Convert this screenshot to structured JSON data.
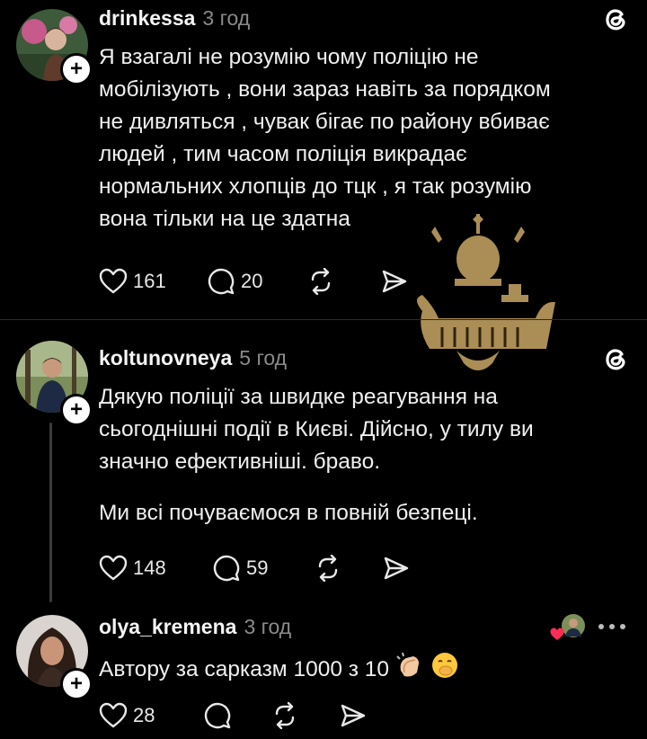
{
  "posts": [
    {
      "username": "drinkessa",
      "time": "3 год",
      "lines": [
        "Я взагалі не розумію чому поліцію не",
        "мобілізують , вони зараз навіть за порядком",
        "не дивляться , чувак бігає по району вбиває",
        "людей , тим часом поліція викрадає",
        "нормальних хлопців до тцк , я так розумію",
        "вона тільки на це здатна"
      ],
      "likes": "161",
      "replies": "20"
    },
    {
      "username": "koltunovneya",
      "time": "5 год",
      "lines": [
        "Дякую поліції за швидке реагування на",
        "сьогоднішні події в Києві. Дійсно, у тилу ви",
        "значно ефективніші. браво."
      ],
      "lines2": [
        "Ми всі почуваємося в повній безпеці."
      ],
      "likes": "148",
      "replies": "59"
    },
    {
      "username": "olya_kremena",
      "time": "3 год",
      "text": "Автору за сарказм 1000 з 10",
      "likes": "28"
    }
  ],
  "icons": {
    "threads": "threads-logo-icon",
    "like": "heart-icon",
    "reply": "comment-icon",
    "repost": "repost-icon",
    "share": "send-icon",
    "more": "more-dots-icon",
    "emoji_1": "clapping-hands-emoji",
    "emoji_2": "hand-over-mouth-emoji"
  }
}
